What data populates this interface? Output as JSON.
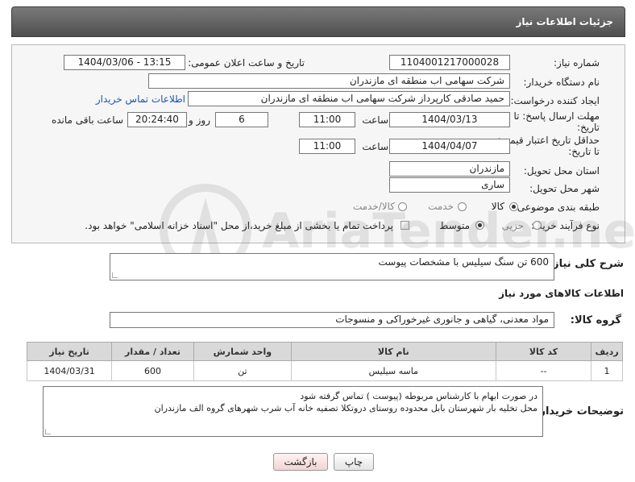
{
  "header": {
    "title": "جزئیات اطلاعات نیاز"
  },
  "fields": {
    "need_number_label": "شماره نیاز:",
    "need_number": "1104001217000028",
    "announce_label": "تاریخ و ساعت اعلان عمومی:",
    "announce_value": "1404/03/06 - 13:15",
    "buyer_org_label": "نام دستگاه خریدار:",
    "buyer_org": "شرکت سهامی اب منطقه ای مازندران",
    "creator_label": "ایجاد کننده درخواست:",
    "creator": "حمید  صادقی کارپرداز شرکت سهامی اب منطقه ای مازندران",
    "contact_link": "اطلاعات تماس خریدار",
    "deadline_label": "مهلت ارسال پاسخ: تا تاریخ:",
    "deadline_date": "1404/03/13",
    "time_label": "ساعت",
    "deadline_time": "11:00",
    "days_value": "6",
    "days_label": "روز و",
    "remaining_time": "20:24:40",
    "remaining_label": "ساعت باقی مانده",
    "price_validity_label": "حداقل تاریخ اعتبار قیمت: تا تاریخ:",
    "price_date": "1404/04/07",
    "price_time": "11:00",
    "province_label": "استان محل تحویل:",
    "province": "مازندران",
    "city_label": "شهر محل تحویل:",
    "city": "ساری",
    "category_label": "طبقه بندی موضوعی:",
    "cat_goods": "کالا",
    "cat_service": "خدمت",
    "cat_both": "کالا/خدمت",
    "process_label": "نوع فرآیند خرید :",
    "proc_partial": "جزیی",
    "proc_medium": "متوسط",
    "payment_note": "پرداخت تمام یا بخشی از مبلغ خرید،از محل \"اسناد خزانه اسلامی\" خواهد بود."
  },
  "summary": {
    "label": "شرح کلی نیاز:",
    "value": "600 تن سنگ سیلیس با مشخصات پیوست"
  },
  "goods_section": {
    "title": "اطلاعات کالاهای مورد نیاز",
    "group_label": "گروه کالا:",
    "group_value": "مواد معدنی، گیاهی و جانوری غیرخوراکی و منسوجات"
  },
  "table": {
    "headers": [
      "ردیف",
      "کد کالا",
      "نام کالا",
      "واحد شمارش",
      "تعداد / مقدار",
      "تاریخ نیاز"
    ],
    "rows": [
      [
        "1",
        "--",
        "ماسه سیلیس",
        "تن",
        "600",
        "1404/03/31"
      ]
    ]
  },
  "buyer_notes": {
    "label": "توضیحات خریدار:",
    "line1": "در صورت ابهام با کارشناس مربوطه (پیوست ) تماس گرفته شود",
    "line2": "محل تخلیه بار شهرستان بابل محدوده روستای دروتکلا تصفیه خانه آب شرب شهرهای گروه الف مازندران"
  },
  "buttons": {
    "print": "چاپ",
    "back": "بازگشت"
  },
  "watermark": {
    "text": "AriaTender.net"
  }
}
